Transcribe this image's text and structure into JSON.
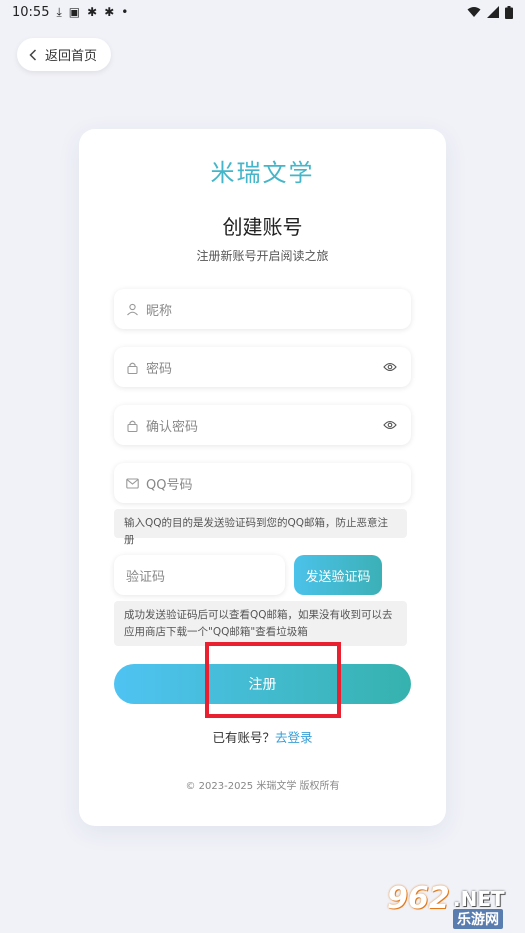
{
  "status_bar": {
    "time": "10:55",
    "icons": [
      "download-icon",
      "image-icon",
      "bug-icon",
      "bug-icon",
      "dot-icon"
    ],
    "right_icons": [
      "wifi-icon",
      "signal-icon",
      "battery-icon"
    ]
  },
  "back_button": {
    "label": "返回首页"
  },
  "card": {
    "brand": "米瑞文学",
    "title": "创建账号",
    "subtitle": "注册新账号开启阅读之旅"
  },
  "form": {
    "nickname_placeholder": "昵称",
    "password_placeholder": "密码",
    "confirm_password_placeholder": "确认密码",
    "qq_placeholder": "QQ号码",
    "qq_hint": "输入QQ的目的是发送验证码到您的QQ邮箱，防止恶意注册",
    "code_placeholder": "验证码",
    "send_code_label": "发送验证码",
    "code_hint": "成功发送验证码后可以查看QQ邮箱，如果没有收到可以去应用商店下载一个\"QQ邮箱\"查看垃圾箱",
    "register_label": "注册"
  },
  "login_prompt": {
    "text": "已有账号？",
    "link": "去登录"
  },
  "copyright": "© 2023-2025 米瑞文学 版权所有",
  "watermark": {
    "number": "962",
    "suffix": ".NET",
    "chinese": "乐游网"
  },
  "colors": {
    "brand": "#45b6c9",
    "button_gradient_start": "#4fc3f2",
    "button_gradient_end": "#36b2ae",
    "link": "#3a9fd8",
    "highlight": "#e8202f"
  }
}
